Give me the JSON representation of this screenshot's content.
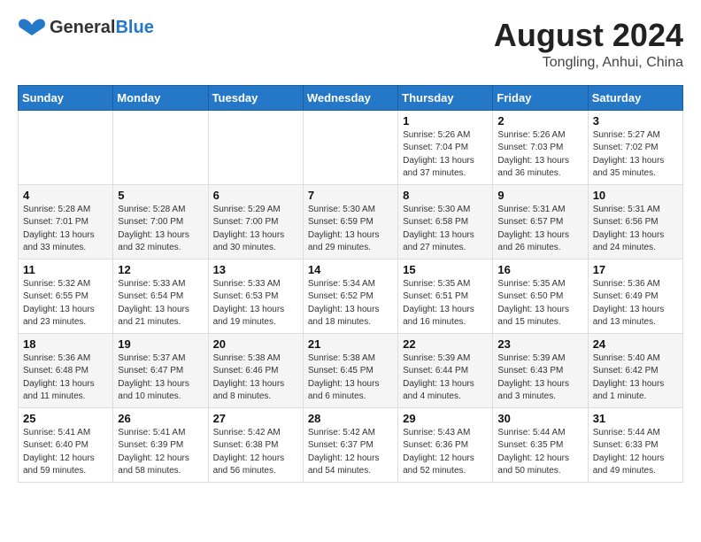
{
  "header": {
    "logo_general": "General",
    "logo_blue": "Blue",
    "month_year": "August 2024",
    "location": "Tongling, Anhui, China"
  },
  "weekdays": [
    "Sunday",
    "Monday",
    "Tuesday",
    "Wednesday",
    "Thursday",
    "Friday",
    "Saturday"
  ],
  "weeks": [
    [
      {
        "day": "",
        "detail": ""
      },
      {
        "day": "",
        "detail": ""
      },
      {
        "day": "",
        "detail": ""
      },
      {
        "day": "",
        "detail": ""
      },
      {
        "day": "1",
        "detail": "Sunrise: 5:26 AM\nSunset: 7:04 PM\nDaylight: 13 hours\nand 37 minutes."
      },
      {
        "day": "2",
        "detail": "Sunrise: 5:26 AM\nSunset: 7:03 PM\nDaylight: 13 hours\nand 36 minutes."
      },
      {
        "day": "3",
        "detail": "Sunrise: 5:27 AM\nSunset: 7:02 PM\nDaylight: 13 hours\nand 35 minutes."
      }
    ],
    [
      {
        "day": "4",
        "detail": "Sunrise: 5:28 AM\nSunset: 7:01 PM\nDaylight: 13 hours\nand 33 minutes."
      },
      {
        "day": "5",
        "detail": "Sunrise: 5:28 AM\nSunset: 7:00 PM\nDaylight: 13 hours\nand 32 minutes."
      },
      {
        "day": "6",
        "detail": "Sunrise: 5:29 AM\nSunset: 7:00 PM\nDaylight: 13 hours\nand 30 minutes."
      },
      {
        "day": "7",
        "detail": "Sunrise: 5:30 AM\nSunset: 6:59 PM\nDaylight: 13 hours\nand 29 minutes."
      },
      {
        "day": "8",
        "detail": "Sunrise: 5:30 AM\nSunset: 6:58 PM\nDaylight: 13 hours\nand 27 minutes."
      },
      {
        "day": "9",
        "detail": "Sunrise: 5:31 AM\nSunset: 6:57 PM\nDaylight: 13 hours\nand 26 minutes."
      },
      {
        "day": "10",
        "detail": "Sunrise: 5:31 AM\nSunset: 6:56 PM\nDaylight: 13 hours\nand 24 minutes."
      }
    ],
    [
      {
        "day": "11",
        "detail": "Sunrise: 5:32 AM\nSunset: 6:55 PM\nDaylight: 13 hours\nand 23 minutes."
      },
      {
        "day": "12",
        "detail": "Sunrise: 5:33 AM\nSunset: 6:54 PM\nDaylight: 13 hours\nand 21 minutes."
      },
      {
        "day": "13",
        "detail": "Sunrise: 5:33 AM\nSunset: 6:53 PM\nDaylight: 13 hours\nand 19 minutes."
      },
      {
        "day": "14",
        "detail": "Sunrise: 5:34 AM\nSunset: 6:52 PM\nDaylight: 13 hours\nand 18 minutes."
      },
      {
        "day": "15",
        "detail": "Sunrise: 5:35 AM\nSunset: 6:51 PM\nDaylight: 13 hours\nand 16 minutes."
      },
      {
        "day": "16",
        "detail": "Sunrise: 5:35 AM\nSunset: 6:50 PM\nDaylight: 13 hours\nand 15 minutes."
      },
      {
        "day": "17",
        "detail": "Sunrise: 5:36 AM\nSunset: 6:49 PM\nDaylight: 13 hours\nand 13 minutes."
      }
    ],
    [
      {
        "day": "18",
        "detail": "Sunrise: 5:36 AM\nSunset: 6:48 PM\nDaylight: 13 hours\nand 11 minutes."
      },
      {
        "day": "19",
        "detail": "Sunrise: 5:37 AM\nSunset: 6:47 PM\nDaylight: 13 hours\nand 10 minutes."
      },
      {
        "day": "20",
        "detail": "Sunrise: 5:38 AM\nSunset: 6:46 PM\nDaylight: 13 hours\nand 8 minutes."
      },
      {
        "day": "21",
        "detail": "Sunrise: 5:38 AM\nSunset: 6:45 PM\nDaylight: 13 hours\nand 6 minutes."
      },
      {
        "day": "22",
        "detail": "Sunrise: 5:39 AM\nSunset: 6:44 PM\nDaylight: 13 hours\nand 4 minutes."
      },
      {
        "day": "23",
        "detail": "Sunrise: 5:39 AM\nSunset: 6:43 PM\nDaylight: 13 hours\nand 3 minutes."
      },
      {
        "day": "24",
        "detail": "Sunrise: 5:40 AM\nSunset: 6:42 PM\nDaylight: 13 hours\nand 1 minute."
      }
    ],
    [
      {
        "day": "25",
        "detail": "Sunrise: 5:41 AM\nSunset: 6:40 PM\nDaylight: 12 hours\nand 59 minutes."
      },
      {
        "day": "26",
        "detail": "Sunrise: 5:41 AM\nSunset: 6:39 PM\nDaylight: 12 hours\nand 58 minutes."
      },
      {
        "day": "27",
        "detail": "Sunrise: 5:42 AM\nSunset: 6:38 PM\nDaylight: 12 hours\nand 56 minutes."
      },
      {
        "day": "28",
        "detail": "Sunrise: 5:42 AM\nSunset: 6:37 PM\nDaylight: 12 hours\nand 54 minutes."
      },
      {
        "day": "29",
        "detail": "Sunrise: 5:43 AM\nSunset: 6:36 PM\nDaylight: 12 hours\nand 52 minutes."
      },
      {
        "day": "30",
        "detail": "Sunrise: 5:44 AM\nSunset: 6:35 PM\nDaylight: 12 hours\nand 50 minutes."
      },
      {
        "day": "31",
        "detail": "Sunrise: 5:44 AM\nSunset: 6:33 PM\nDaylight: 12 hours\nand 49 minutes."
      }
    ]
  ]
}
